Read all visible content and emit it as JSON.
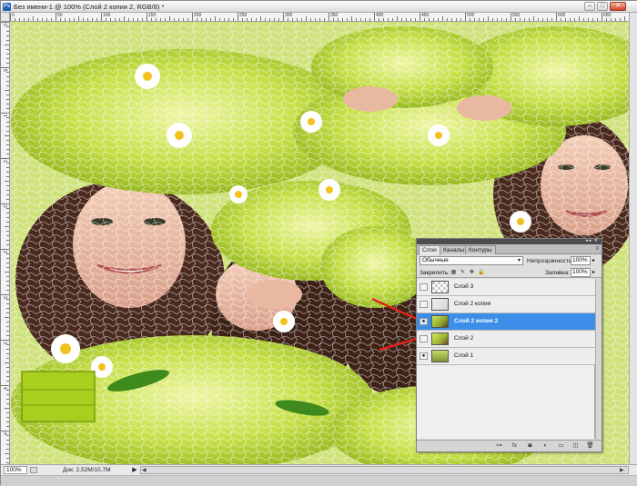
{
  "window": {
    "app_icon_text": "Ps",
    "title": "Без имени-1 @ 100% (Слой 2 копия 2, RGB/8) *",
    "buttons": {
      "minimize": "–",
      "maximize": "□",
      "close": "✕"
    }
  },
  "ruler": {
    "top_numbers": [
      "0",
      "50",
      "100",
      "150",
      "200",
      "250",
      "300",
      "350",
      "400",
      "450",
      "500",
      "550",
      "600",
      "650"
    ],
    "left_numbers": [
      "0",
      "5",
      "1",
      "1",
      "2",
      "2",
      "3",
      "3",
      "4",
      "4"
    ]
  },
  "status": {
    "zoom": "100%",
    "doc_size": "Док: 2,52M/10,7M",
    "arrow": "▶",
    "hscroll_left": "◀",
    "hscroll_right": "▶"
  },
  "layers_panel": {
    "collapse": "◂◂ ✕",
    "tabs": [
      {
        "label": "Слои",
        "active": true
      },
      {
        "label": "Каналы",
        "active": false
      },
      {
        "label": "Контуры",
        "active": false
      }
    ],
    "menu_icon": "≡",
    "blend_mode": "Обычные",
    "dropdown_arrow": "▾",
    "opacity_label": "Непрозрачность:",
    "opacity_value": "100%",
    "field_arrow": "▸",
    "lock_label": "Закрепить:",
    "lock_icons": [
      "▦",
      "✎",
      "✥",
      "🔒"
    ],
    "fill_label": "Заливка:",
    "fill_value": "100%",
    "layers": [
      {
        "name": "Слой 3",
        "visible": false,
        "selected": false,
        "eye": ""
      },
      {
        "name": "Слой 2 копия",
        "visible": false,
        "selected": false,
        "eye": ""
      },
      {
        "name": "Слой 2 копия 2",
        "visible": true,
        "selected": true,
        "eye": "●"
      },
      {
        "name": "Слой 2",
        "visible": false,
        "selected": false,
        "eye": ""
      },
      {
        "name": "Слой 1",
        "visible": true,
        "selected": false,
        "eye": "●"
      }
    ],
    "footer_icons": [
      "⊶",
      "fx",
      "◙",
      "◐",
      "▭",
      "◫",
      "🗑"
    ]
  },
  "colors": {
    "selected_layer": "#3d8ee9",
    "canvas_green": "#c9dc7a",
    "annotation_arrow": "#e0231b"
  }
}
